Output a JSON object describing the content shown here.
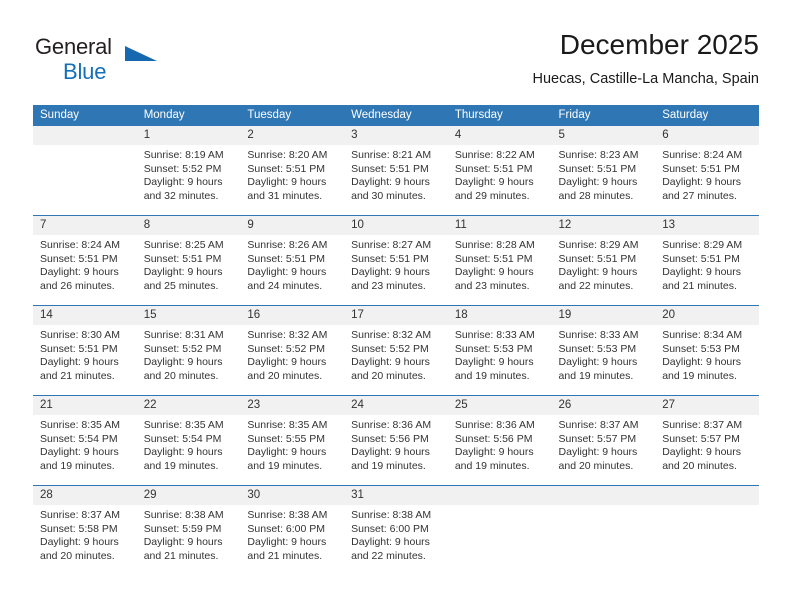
{
  "brand": {
    "name_top": "General",
    "name_bottom": "Blue",
    "accent_color": "#1570b8"
  },
  "header": {
    "title": "December 2025",
    "subtitle": "Huecas, Castille-La Mancha, Spain"
  },
  "theme": {
    "header_blue": "#2f76b4",
    "daynum_bg": "#f1f1f1",
    "text": "#333333"
  },
  "calendar": {
    "weekday_headers": [
      "Sunday",
      "Monday",
      "Tuesday",
      "Wednesday",
      "Thursday",
      "Friday",
      "Saturday"
    ],
    "weeks": [
      [
        {
          "day": "",
          "sunrise": "",
          "sunset": "",
          "daylight_1": "",
          "daylight_2": ""
        },
        {
          "day": "1",
          "sunrise": "Sunrise: 8:19 AM",
          "sunset": "Sunset: 5:52 PM",
          "daylight_1": "Daylight: 9 hours",
          "daylight_2": "and 32 minutes."
        },
        {
          "day": "2",
          "sunrise": "Sunrise: 8:20 AM",
          "sunset": "Sunset: 5:51 PM",
          "daylight_1": "Daylight: 9 hours",
          "daylight_2": "and 31 minutes."
        },
        {
          "day": "3",
          "sunrise": "Sunrise: 8:21 AM",
          "sunset": "Sunset: 5:51 PM",
          "daylight_1": "Daylight: 9 hours",
          "daylight_2": "and 30 minutes."
        },
        {
          "day": "4",
          "sunrise": "Sunrise: 8:22 AM",
          "sunset": "Sunset: 5:51 PM",
          "daylight_1": "Daylight: 9 hours",
          "daylight_2": "and 29 minutes."
        },
        {
          "day": "5",
          "sunrise": "Sunrise: 8:23 AM",
          "sunset": "Sunset: 5:51 PM",
          "daylight_1": "Daylight: 9 hours",
          "daylight_2": "and 28 minutes."
        },
        {
          "day": "6",
          "sunrise": "Sunrise: 8:24 AM",
          "sunset": "Sunset: 5:51 PM",
          "daylight_1": "Daylight: 9 hours",
          "daylight_2": "and 27 minutes."
        }
      ],
      [
        {
          "day": "7",
          "sunrise": "Sunrise: 8:24 AM",
          "sunset": "Sunset: 5:51 PM",
          "daylight_1": "Daylight: 9 hours",
          "daylight_2": "and 26 minutes."
        },
        {
          "day": "8",
          "sunrise": "Sunrise: 8:25 AM",
          "sunset": "Sunset: 5:51 PM",
          "daylight_1": "Daylight: 9 hours",
          "daylight_2": "and 25 minutes."
        },
        {
          "day": "9",
          "sunrise": "Sunrise: 8:26 AM",
          "sunset": "Sunset: 5:51 PM",
          "daylight_1": "Daylight: 9 hours",
          "daylight_2": "and 24 minutes."
        },
        {
          "day": "10",
          "sunrise": "Sunrise: 8:27 AM",
          "sunset": "Sunset: 5:51 PM",
          "daylight_1": "Daylight: 9 hours",
          "daylight_2": "and 23 minutes."
        },
        {
          "day": "11",
          "sunrise": "Sunrise: 8:28 AM",
          "sunset": "Sunset: 5:51 PM",
          "daylight_1": "Daylight: 9 hours",
          "daylight_2": "and 23 minutes."
        },
        {
          "day": "12",
          "sunrise": "Sunrise: 8:29 AM",
          "sunset": "Sunset: 5:51 PM",
          "daylight_1": "Daylight: 9 hours",
          "daylight_2": "and 22 minutes."
        },
        {
          "day": "13",
          "sunrise": "Sunrise: 8:29 AM",
          "sunset": "Sunset: 5:51 PM",
          "daylight_1": "Daylight: 9 hours",
          "daylight_2": "and 21 minutes."
        }
      ],
      [
        {
          "day": "14",
          "sunrise": "Sunrise: 8:30 AM",
          "sunset": "Sunset: 5:51 PM",
          "daylight_1": "Daylight: 9 hours",
          "daylight_2": "and 21 minutes."
        },
        {
          "day": "15",
          "sunrise": "Sunrise: 8:31 AM",
          "sunset": "Sunset: 5:52 PM",
          "daylight_1": "Daylight: 9 hours",
          "daylight_2": "and 20 minutes."
        },
        {
          "day": "16",
          "sunrise": "Sunrise: 8:32 AM",
          "sunset": "Sunset: 5:52 PM",
          "daylight_1": "Daylight: 9 hours",
          "daylight_2": "and 20 minutes."
        },
        {
          "day": "17",
          "sunrise": "Sunrise: 8:32 AM",
          "sunset": "Sunset: 5:52 PM",
          "daylight_1": "Daylight: 9 hours",
          "daylight_2": "and 20 minutes."
        },
        {
          "day": "18",
          "sunrise": "Sunrise: 8:33 AM",
          "sunset": "Sunset: 5:53 PM",
          "daylight_1": "Daylight: 9 hours",
          "daylight_2": "and 19 minutes."
        },
        {
          "day": "19",
          "sunrise": "Sunrise: 8:33 AM",
          "sunset": "Sunset: 5:53 PM",
          "daylight_1": "Daylight: 9 hours",
          "daylight_2": "and 19 minutes."
        },
        {
          "day": "20",
          "sunrise": "Sunrise: 8:34 AM",
          "sunset": "Sunset: 5:53 PM",
          "daylight_1": "Daylight: 9 hours",
          "daylight_2": "and 19 minutes."
        }
      ],
      [
        {
          "day": "21",
          "sunrise": "Sunrise: 8:35 AM",
          "sunset": "Sunset: 5:54 PM",
          "daylight_1": "Daylight: 9 hours",
          "daylight_2": "and 19 minutes."
        },
        {
          "day": "22",
          "sunrise": "Sunrise: 8:35 AM",
          "sunset": "Sunset: 5:54 PM",
          "daylight_1": "Daylight: 9 hours",
          "daylight_2": "and 19 minutes."
        },
        {
          "day": "23",
          "sunrise": "Sunrise: 8:35 AM",
          "sunset": "Sunset: 5:55 PM",
          "daylight_1": "Daylight: 9 hours",
          "daylight_2": "and 19 minutes."
        },
        {
          "day": "24",
          "sunrise": "Sunrise: 8:36 AM",
          "sunset": "Sunset: 5:56 PM",
          "daylight_1": "Daylight: 9 hours",
          "daylight_2": "and 19 minutes."
        },
        {
          "day": "25",
          "sunrise": "Sunrise: 8:36 AM",
          "sunset": "Sunset: 5:56 PM",
          "daylight_1": "Daylight: 9 hours",
          "daylight_2": "and 19 minutes."
        },
        {
          "day": "26",
          "sunrise": "Sunrise: 8:37 AM",
          "sunset": "Sunset: 5:57 PM",
          "daylight_1": "Daylight: 9 hours",
          "daylight_2": "and 20 minutes."
        },
        {
          "day": "27",
          "sunrise": "Sunrise: 8:37 AM",
          "sunset": "Sunset: 5:57 PM",
          "daylight_1": "Daylight: 9 hours",
          "daylight_2": "and 20 minutes."
        }
      ],
      [
        {
          "day": "28",
          "sunrise": "Sunrise: 8:37 AM",
          "sunset": "Sunset: 5:58 PM",
          "daylight_1": "Daylight: 9 hours",
          "daylight_2": "and 20 minutes."
        },
        {
          "day": "29",
          "sunrise": "Sunrise: 8:38 AM",
          "sunset": "Sunset: 5:59 PM",
          "daylight_1": "Daylight: 9 hours",
          "daylight_2": "and 21 minutes."
        },
        {
          "day": "30",
          "sunrise": "Sunrise: 8:38 AM",
          "sunset": "Sunset: 6:00 PM",
          "daylight_1": "Daylight: 9 hours",
          "daylight_2": "and 21 minutes."
        },
        {
          "day": "31",
          "sunrise": "Sunrise: 8:38 AM",
          "sunset": "Sunset: 6:00 PM",
          "daylight_1": "Daylight: 9 hours",
          "daylight_2": "and 22 minutes."
        },
        {
          "day": "",
          "sunrise": "",
          "sunset": "",
          "daylight_1": "",
          "daylight_2": ""
        },
        {
          "day": "",
          "sunrise": "",
          "sunset": "",
          "daylight_1": "",
          "daylight_2": ""
        },
        {
          "day": "",
          "sunrise": "",
          "sunset": "",
          "daylight_1": "",
          "daylight_2": ""
        }
      ]
    ]
  }
}
